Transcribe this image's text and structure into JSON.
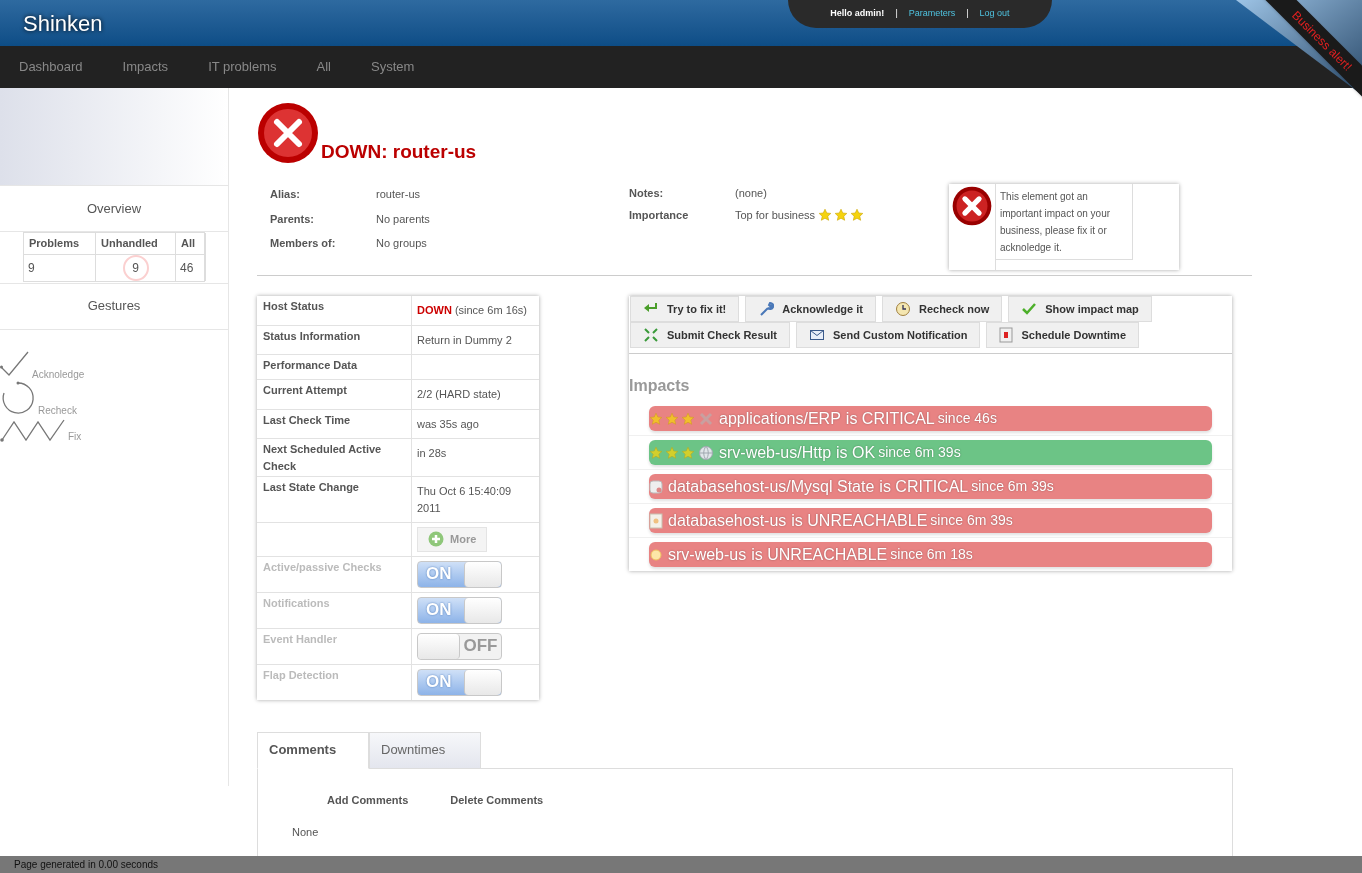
{
  "header": {
    "brand": "Shinken",
    "greeting": "Hello admin!",
    "separators": [
      "|",
      "|"
    ],
    "links": [
      "Parameters",
      "Log out"
    ],
    "ribbon": "Business alert!"
  },
  "nav": [
    "Dashboard",
    "Impacts",
    "IT problems",
    "All",
    "System"
  ],
  "sidebar": {
    "overview_title": "Overview",
    "counts": [
      {
        "label": "Problems",
        "value": "9",
        "highlighted": false
      },
      {
        "label": "Unhandled",
        "value": "9",
        "highlighted": true
      },
      {
        "label": "All",
        "value": "46",
        "highlighted": false
      }
    ],
    "gestures_title": "Gestures",
    "gestures": [
      {
        "kind": "check",
        "label": "Acknoledge"
      },
      {
        "kind": "circle",
        "label": "Recheck"
      },
      {
        "kind": "zigzag",
        "label": "Fix"
      }
    ]
  },
  "host": {
    "title": "DOWN: router-us",
    "details_left": [
      {
        "label": "Alias:",
        "value": "router-us"
      },
      {
        "label": "Parents:",
        "value": "No parents"
      },
      {
        "label": "Members of:",
        "value": "No groups"
      }
    ],
    "details_right": [
      {
        "label": "Notes:",
        "value": "(none)"
      },
      {
        "label": "Importance",
        "value": "Top for business",
        "stars": 3
      }
    ],
    "alert": "This element got an important impact on your business, please fix it or acknoledge it."
  },
  "status_rows": [
    {
      "kind": "state",
      "label": "Host Status",
      "state": "DOWN",
      "since": "(since 6m 16s)"
    },
    {
      "kind": "text",
      "label": "Status Information",
      "value": "Return in Dummy 2"
    },
    {
      "kind": "text",
      "label": "Performance Data"
    },
    {
      "kind": "text",
      "label": "Current Attempt",
      "value": "2/2 (HARD state)"
    },
    {
      "kind": "text",
      "label": "Last Check Time",
      "value": "was 35s ago"
    },
    {
      "kind": "text",
      "label": "Next Scheduled Active Check",
      "value": "in 28s"
    },
    {
      "kind": "text",
      "label": "Last State Change",
      "value": "Thu Oct 6 15:40:09 2011"
    },
    {
      "kind": "button",
      "value": "More"
    },
    {
      "kind": "toggle",
      "label": "Active/passive Checks",
      "on": true,
      "text": "ON"
    },
    {
      "kind": "toggle",
      "label": "Notifications",
      "on": true,
      "text": "ON"
    },
    {
      "kind": "toggle",
      "label": "Event Handler",
      "on": false,
      "text": "OFF"
    },
    {
      "kind": "toggle",
      "label": "Flap Detection",
      "on": true,
      "text": "ON"
    }
  ],
  "actions": [
    {
      "kind": "fix",
      "label": "Try to fix it!"
    },
    {
      "kind": "wrench",
      "label": "Acknowledge it"
    },
    {
      "kind": "clock",
      "label": "Recheck now"
    },
    {
      "kind": "check",
      "label": "Show impact map"
    },
    {
      "kind": "arrows",
      "label": "Submit Check Result"
    },
    {
      "kind": "mail",
      "label": "Send Custom Notification"
    },
    {
      "kind": "calendar",
      "label": "Schedule Downtime"
    }
  ],
  "impacts_title": "Impacts",
  "impacts": [
    {
      "kind": "app",
      "color": "#e88383",
      "stars": 3,
      "name": "applications/ERP",
      "state": "is CRITICAL",
      "since": "since 46s"
    },
    {
      "kind": "globe",
      "color": "#6cc486",
      "stars": 3,
      "name": "srv-web-us/Http",
      "state": "is OK",
      "since": "since 6m 39s"
    },
    {
      "kind": "database",
      "color": "#e88383",
      "name": "databasehost-us/Mysql State",
      "state": "is CRITICAL",
      "since": "since 6m 39s"
    },
    {
      "kind": "server",
      "color": "#e88383",
      "name": "databasehost-us",
      "state": "is UNREACHABLE",
      "since": "since 6m 39s"
    },
    {
      "kind": "sun",
      "color": "#e88383",
      "name": "srv-web-us",
      "state": "is UNREACHABLE",
      "since": "since 6m 18s"
    }
  ],
  "tabs": [
    {
      "label": "Comments",
      "selected": true
    },
    {
      "label": "Downtimes",
      "selected": false
    }
  ],
  "comment_actions": [
    "Add Comments",
    "Delete Comments"
  ],
  "comments_empty": "None",
  "footer": "Page generated in 0.00 seconds"
}
